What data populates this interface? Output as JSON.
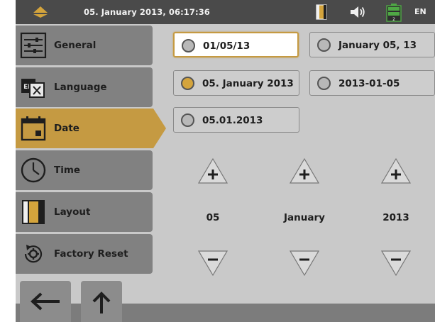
{
  "status_bar": {
    "datetime": "05. January 2013, 06:17:36",
    "language": "EN",
    "icons": [
      "pyramid-logo",
      "layout-icon",
      "speaker-icon",
      "battery-icon"
    ]
  },
  "sidebar": {
    "items": [
      {
        "label": "General",
        "icon": "sliders-icon",
        "active": false
      },
      {
        "label": "Language",
        "icon": "language-icon",
        "active": false
      },
      {
        "label": "Date",
        "icon": "calendar-icon",
        "active": true
      },
      {
        "label": "Time",
        "icon": "clock-icon",
        "active": false
      },
      {
        "label": "Layout",
        "icon": "layout-icon",
        "active": false
      },
      {
        "label": "Factory Reset",
        "icon": "factory-reset-icon",
        "active": false
      }
    ]
  },
  "date_formats": {
    "options": [
      {
        "label": "01/05/13",
        "selected": true
      },
      {
        "label": "January 05, 13",
        "selected": false
      },
      {
        "label": "05. January 2013",
        "selected": false,
        "radio_filled": true
      },
      {
        "label": "2013-01-05",
        "selected": false
      },
      {
        "label": "05.01.2013",
        "selected": false
      }
    ]
  },
  "date_spinners": {
    "day": "05",
    "month": "January",
    "year": "2013"
  },
  "navigation": {
    "back": "back-arrow-icon",
    "up": "up-arrow-icon"
  },
  "colors": {
    "accent": "#c59a42",
    "sidebar": "#818181",
    "background": "#c9c9c9",
    "topbar": "#4a4a4a",
    "battery": "#4fa845"
  }
}
